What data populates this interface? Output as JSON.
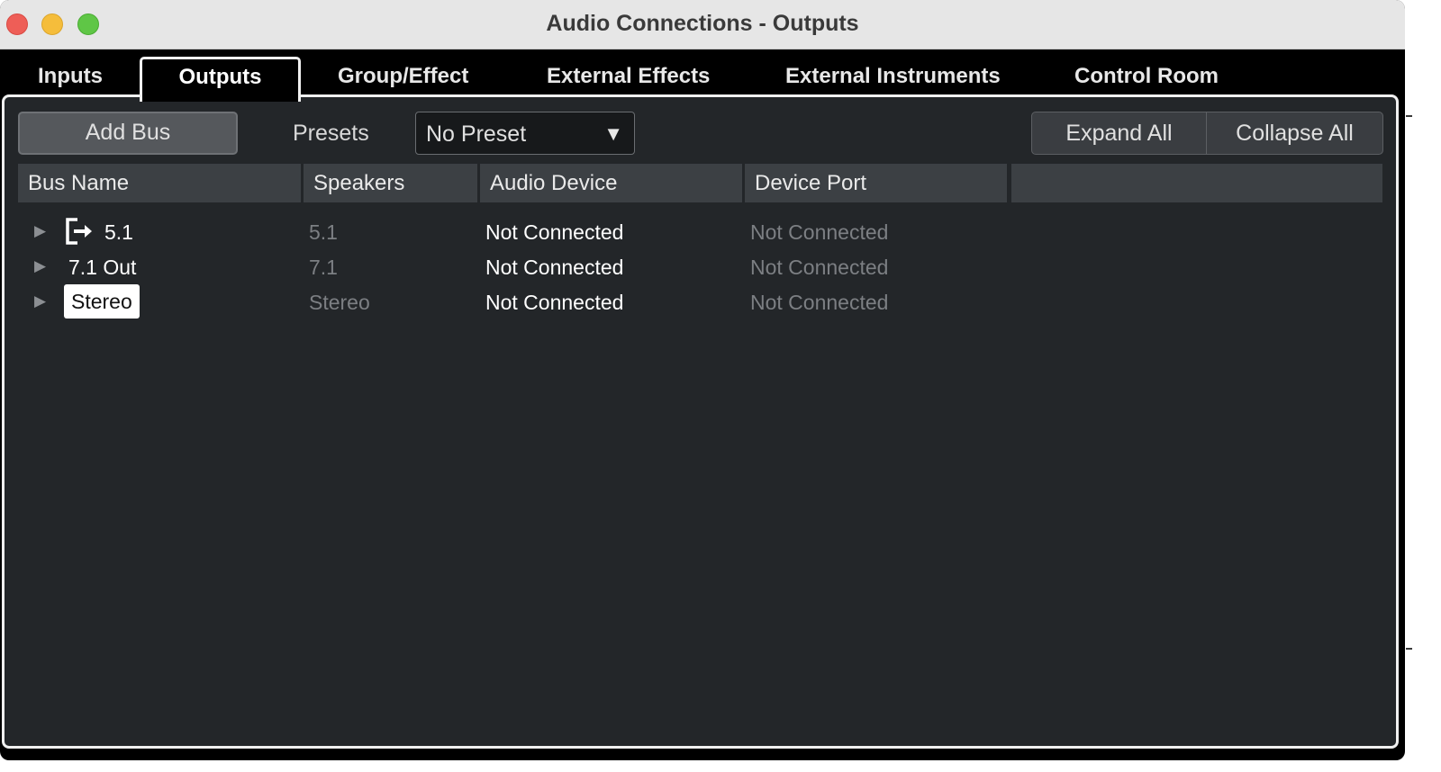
{
  "window": {
    "title": "Audio Connections - Outputs"
  },
  "tabs": [
    {
      "label": "Inputs",
      "active": false
    },
    {
      "label": "Outputs",
      "active": true
    },
    {
      "label": "Group/Effect",
      "active": false
    },
    {
      "label": "External Effects",
      "active": false
    },
    {
      "label": "External Instruments",
      "active": false
    },
    {
      "label": "Control Room",
      "active": false
    }
  ],
  "toolbar": {
    "add_bus_label": "Add Bus",
    "presets_label": "Presets",
    "preset_value": "No Preset",
    "expand_all_label": "Expand All",
    "collapse_all_label": "Collapse All"
  },
  "table": {
    "columns": [
      "Bus Name",
      "Speakers",
      "Audio Device",
      "Device Port",
      ""
    ],
    "rows": [
      {
        "name": "5.1",
        "speakers": "5.1",
        "audio_device": "Not Connected",
        "device_port": "Not Connected",
        "icon": "output-bus-icon",
        "selected": false
      },
      {
        "name": "7.1 Out",
        "speakers": "7.1",
        "audio_device": "Not Connected",
        "device_port": "Not Connected",
        "selected": false
      },
      {
        "name": "Stereo",
        "speakers": "Stereo",
        "audio_device": "Not Connected",
        "device_port": "Not Connected",
        "selected": true
      }
    ]
  },
  "colors": {
    "panel_background": "#232629",
    "header_background": "#3c4044",
    "titlebar": "#e6e6e6",
    "close": "#ee5e57",
    "minimize": "#f5bd3b",
    "zoom": "#5fc646",
    "dim_text": "#7c7f83"
  }
}
